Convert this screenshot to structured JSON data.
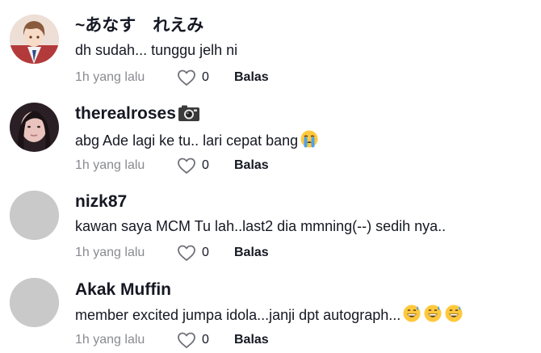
{
  "comments": [
    {
      "username": "~あなす　れえみ",
      "text": "dh sudah... tunggu jelh ni",
      "emoji": [],
      "time": "1h yang lalu",
      "likes": "0",
      "reply": "Balas",
      "avatar_icon": "anime-boy-avatar-icon"
    },
    {
      "username": "therealroses",
      "username_emoji": [
        "camera-icon"
      ],
      "text": "abg Ade lagi ke tu.. lari cepat bang",
      "emoji": [
        "loudly-crying-face-icon"
      ],
      "time": "1h yang lalu",
      "likes": "0",
      "reply": "Balas",
      "avatar_icon": "girl-photo-avatar-icon"
    },
    {
      "username": "nizk87",
      "text": "kawan saya MCM Tu lah..last2 dia mmning(--) sedih nya..",
      "emoji": [],
      "time": "1h yang lalu",
      "likes": "0",
      "reply": "Balas",
      "avatar_icon": "default-avatar-icon"
    },
    {
      "username": "Akak Muffin",
      "text": "member excited jumpa idola...janji dpt autograph...",
      "emoji": [
        "grinning-sweat-face-icon",
        "grinning-sweat-face-icon",
        "grinning-sweat-face-icon"
      ],
      "time": "1h yang lalu",
      "likes": "0",
      "reply": "Balas",
      "avatar_icon": "default-avatar-icon"
    }
  ],
  "colors": {
    "text": "#161823",
    "muted": "#8a8b91",
    "avatar_placeholder": "#c9c9c9",
    "emoji_yellow": "#ffc83d"
  }
}
